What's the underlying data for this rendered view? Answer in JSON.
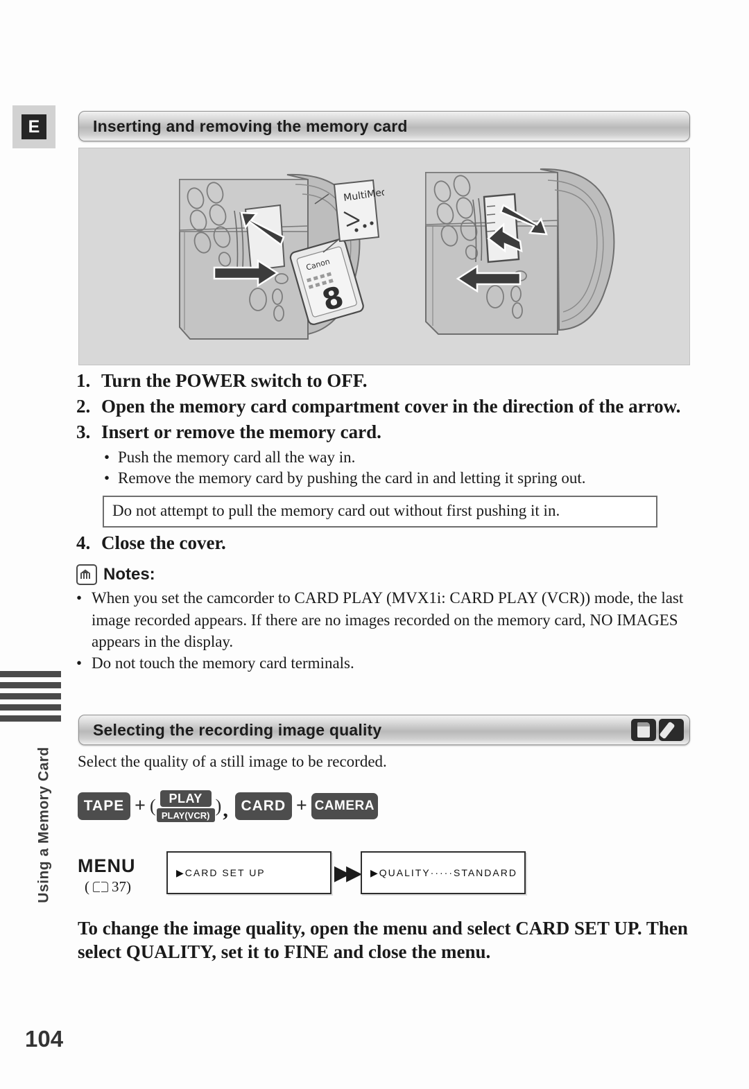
{
  "page": {
    "number": "104",
    "language_badge": "E",
    "side_tab": "Using a Memory Card"
  },
  "section1": {
    "title": "Inserting and removing the memory card",
    "illustration": {
      "callout_label": "MultiMedia",
      "card_brand": "Canon",
      "card_capacity": "8",
      "left_panel_name": "inserting-memory-card-illustration",
      "right_panel_name": "removing-memory-card-illustration"
    },
    "steps": [
      {
        "num": "1.",
        "text": "Turn the POWER switch to OFF."
      },
      {
        "num": "2.",
        "text": "Open the memory card compartment cover in the direction of the arrow."
      },
      {
        "num": "3.",
        "text": "Insert or remove the memory card."
      },
      {
        "num": "4.",
        "text": "Close the cover."
      }
    ],
    "bullets": [
      "Push the memory card all the way in.",
      "Remove the memory card by pushing the card in and letting it spring out."
    ],
    "warning": "Do not attempt to pull the memory card out without first pushing it in.",
    "notes_label": "Notes:",
    "notes": [
      "When you set the camcorder to CARD PLAY (MVX1i: CARD PLAY (VCR)) mode, the last image recorded appears. If there are no images recorded on the memory card, NO IMAGES appears in the display.",
      "Do not touch the memory card terminals."
    ]
  },
  "section2": {
    "title": "Selecting the recording image quality",
    "header_icons": [
      "memory-card-icon",
      "pen-icon"
    ],
    "lead": "Select the quality of a still image to be recorded.",
    "mode_buttons": {
      "tape": "TAPE",
      "plus1": "+",
      "open_paren": "(",
      "play": "PLAY",
      "play_vcr": "PLAY(VCR)",
      "close_paren": ")",
      "comma": ",",
      "card": "CARD",
      "plus2": "+",
      "camera": "CAMERA"
    },
    "menu": {
      "label": "MENU",
      "page_ref": "37)",
      "page_ref_open": "(",
      "box1": "▶CARD SET UP",
      "box2": "▶QUALITY·····STANDARD"
    },
    "closing": "To change the image quality, open the menu and select CARD SET UP. Then select QUALITY, set it to FINE and close the menu."
  }
}
